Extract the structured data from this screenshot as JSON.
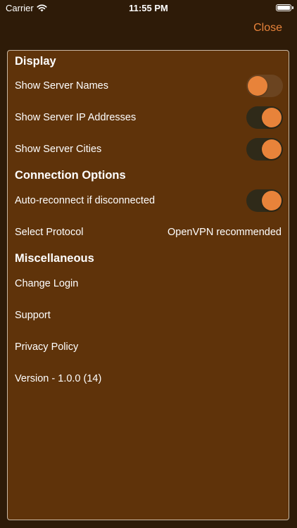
{
  "status_bar": {
    "carrier": "Carrier",
    "time": "11:55 PM",
    "wifi_icon": "wifi-icon",
    "battery_icon": "battery-icon"
  },
  "header": {
    "close_label": "Close"
  },
  "display": {
    "title": "Display",
    "show_server_names": {
      "label": "Show Server Names",
      "on": false
    },
    "show_server_ip": {
      "label": "Show Server IP Addresses",
      "on": true
    },
    "show_server_cities": {
      "label": "Show Server Cities",
      "on": true
    }
  },
  "connection": {
    "title": "Connection Options",
    "auto_reconnect": {
      "label": "Auto-reconnect if disconnected",
      "on": true
    },
    "protocol": {
      "label": "Select Protocol",
      "value": "OpenVPN recommended"
    }
  },
  "misc": {
    "title": "Miscellaneous",
    "change_login": "Change Login",
    "support": "Support",
    "privacy_policy": "Privacy Policy",
    "version": "Version - 1.0.0 (14)"
  },
  "colors": {
    "background": "#2e1b08",
    "panel": "#5f330a",
    "accent": "#e8833a",
    "toggle_track_on": "#2f2a19",
    "toggle_track_off": "#6b4420"
  }
}
